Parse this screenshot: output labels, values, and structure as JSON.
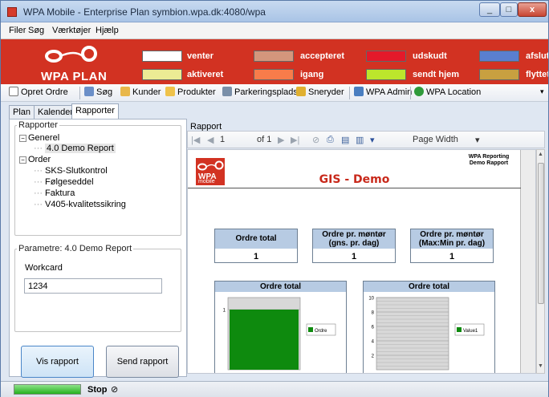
{
  "window": {
    "title": "WPA Mobile - Enterprise Plan symbion.wpa.dk:4080/wpa"
  },
  "menu": [
    "Filer",
    "Søg",
    "Værktøjer",
    "Hjælp"
  ],
  "banner": {
    "logo_text": "WPA PLAN",
    "legend": [
      {
        "label": "venter",
        "color": "#ffffff"
      },
      {
        "label": "accepteret",
        "color": "#d4967c"
      },
      {
        "label": "udskudt",
        "color": "#e4192a"
      },
      {
        "label": "afslut",
        "color": "#5a7fd0"
      },
      {
        "label": "aktiveret",
        "color": "#ecec94"
      },
      {
        "label": "igang",
        "color": "#f87c4a"
      },
      {
        "label": "sendt hjem",
        "color": "#bce62c"
      },
      {
        "label": "flyttet",
        "color": "#c8a040"
      }
    ]
  },
  "toolbar": {
    "opret_ordre": "Opret Ordre",
    "soeg": "Søg",
    "kunder": "Kunder",
    "produkter": "Produkter",
    "parkeringsplads": "Parkeringsplads",
    "sneryder": "Sneryder",
    "wpa_admin": "WPA Admin",
    "wpa_location": "WPA Location"
  },
  "tabs": [
    "Plan",
    "Kalender",
    "Rapporter"
  ],
  "left": {
    "reports_group": "Rapporter",
    "tree": {
      "generel": "Generel",
      "demo_report": "4.0 Demo Report",
      "order": "Order",
      "sks": "SKS-Slutkontrol",
      "foelgeseddel": "Følgeseddel",
      "faktura": "Faktura",
      "v405": "V405-kvalitetssikring"
    },
    "param_group": "Parametre: 4.0 Demo Report",
    "workcard_label": "Workcard",
    "workcard_value": "1234",
    "vis_rapport": "Vis rapport",
    "send_rapport": "Send rapport"
  },
  "report": {
    "label": "Rapport",
    "toolbar": {
      "page_current": "1",
      "page_of": "of 1",
      "zoom": "Page Width"
    },
    "logo": "WPA",
    "logo_sub": "mobile",
    "title": "GIS - Demo",
    "header_right_1": "WPA Reporting",
    "header_right_2": "Demo Rapport",
    "kpis": [
      {
        "title": "Ordre total",
        "value": "1"
      },
      {
        "title": "Ordre pr. møntør (gns. pr. dag)",
        "value": "1"
      },
      {
        "title": "Ordre pr. møntør (Max:Min pr. dag)",
        "value": "1"
      }
    ]
  },
  "chart_data": [
    {
      "type": "bar",
      "title": "Ordre total",
      "categories": [
        ""
      ],
      "series": [
        {
          "name": "Ordre",
          "values": [
            1
          ]
        }
      ],
      "ylim": [
        0,
        1.2
      ],
      "yticks": [
        "1"
      ],
      "grid": true,
      "legend": "right",
      "colors": [
        "#0e8a0e"
      ]
    },
    {
      "type": "bar",
      "title": "Ordre total",
      "categories": [
        ""
      ],
      "series": [
        {
          "name": "Value1",
          "values": []
        }
      ],
      "ylim": [
        0,
        10
      ],
      "yticks": [
        "2",
        "4",
        "6",
        "8",
        "10"
      ],
      "grid": true,
      "legend": "right",
      "colors": [
        "#0e8a0e"
      ]
    }
  ],
  "status": {
    "stop": "Stop",
    "progress": 1.0
  }
}
